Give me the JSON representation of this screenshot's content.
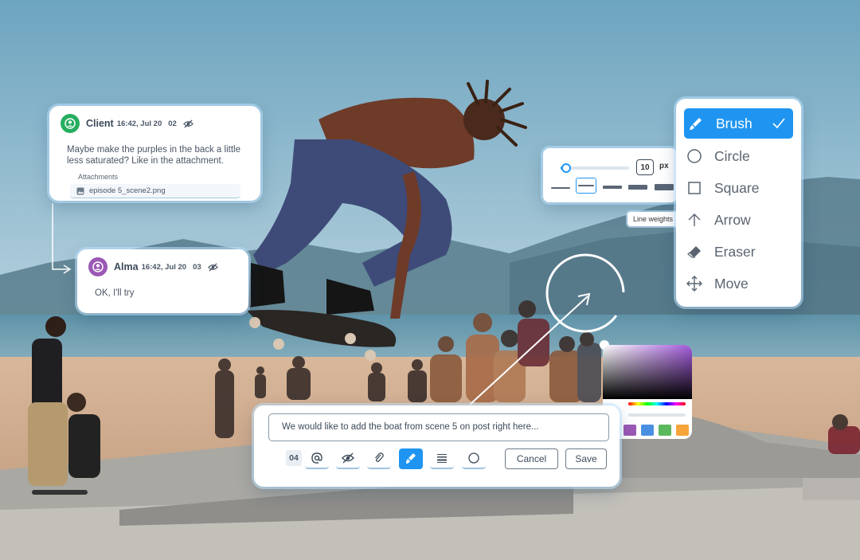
{
  "comments": [
    {
      "name": "Client",
      "time": "16:42, Jul 20",
      "number": "02",
      "avatar_color": "#27ae60",
      "body_lines": [
        "Maybe make the purples in the back a little",
        "less saturated? Like in the attachment."
      ],
      "attachments_label": "Attachments",
      "attachment_file": "episode 5_scene2.png"
    },
    {
      "name": "Alma",
      "time": "16:42, Jul 20",
      "number": "03",
      "avatar_color": "#9b59b6",
      "body_lines": [
        "OK, I'll try"
      ]
    }
  ],
  "tools": [
    {
      "label": "Brush",
      "icon": "brush-icon",
      "active": true
    },
    {
      "label": "Circle",
      "icon": "circle-icon",
      "active": false
    },
    {
      "label": "Square",
      "icon": "square-icon",
      "active": false
    },
    {
      "label": "Arrow",
      "icon": "arrow-icon",
      "active": false
    },
    {
      "label": "Eraser",
      "icon": "eraser-icon",
      "active": false
    },
    {
      "label": "Move",
      "icon": "move-icon",
      "active": false
    }
  ],
  "line_weight": {
    "value": "10",
    "unit": "px",
    "slider_fraction": 0.03,
    "tooltip": "Line weights"
  },
  "color_picker": {
    "selected_hue": "#a35bdc",
    "swatches": [
      "#9b59b6",
      "#4a90e2",
      "#5cb85c",
      "#f5a53a"
    ]
  },
  "compose": {
    "message": "We would like to add the boat from scene 5 on post right here...",
    "comment_number": "04",
    "cancel_label": "Cancel",
    "save_label": "Save",
    "toolbar_icons": [
      "mention-icon",
      "hide-icon",
      "attach-icon",
      "brush-icon",
      "line-weight-icon",
      "circle-icon"
    ]
  },
  "colors": {
    "accent": "#1f95f1"
  }
}
